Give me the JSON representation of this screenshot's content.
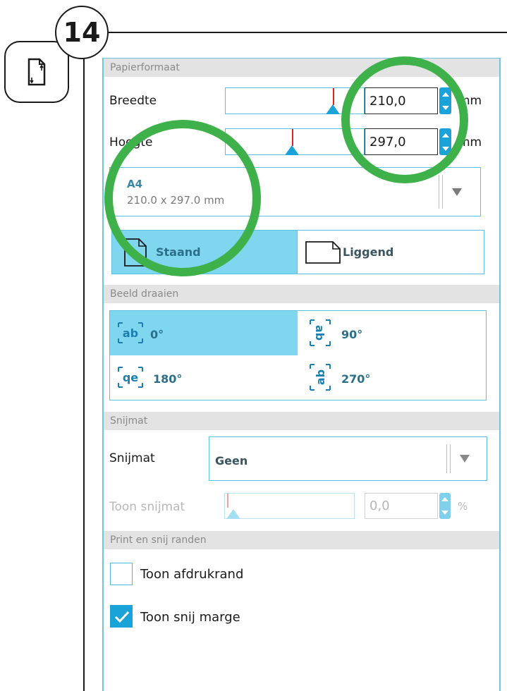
{
  "step_number": "14",
  "side_icon": "page-orientation-icon",
  "sections": {
    "paper": "Papierformaat",
    "rotate": "Beeld draaien",
    "mat": "Snijmat",
    "print_cut": "Print en snij randen"
  },
  "width": {
    "label": "Breedte",
    "value": "210,0",
    "unit": "mm"
  },
  "height": {
    "label": "Hoogte",
    "value": "297,0",
    "unit": "mm"
  },
  "paper_preset": {
    "name": "A4",
    "size": "210.0 x 297.0 mm"
  },
  "orientation": {
    "portrait": "Staand",
    "landscape": "Liggend",
    "selected": "Staand"
  },
  "rotation": {
    "options": [
      "0°",
      "90°",
      "180°",
      "270°"
    ],
    "selected": "0°",
    "glyph_ab": "ab",
    "glyph_qe": "qe"
  },
  "mat": {
    "label": "Snijmat",
    "value": "Geen",
    "show_label": "Toon snijmat",
    "show_value": "0,0",
    "show_unit": "%"
  },
  "print_cut": {
    "show_print_border": {
      "label": "Toon afdrukrand",
      "checked": false
    },
    "show_cut_margin": {
      "label": "Toon snij marge",
      "checked": true
    }
  },
  "colors": {
    "accent": "#1aa3d9",
    "selected_fill": "#7fd6ef",
    "highlight_ring": "#3fb14a",
    "slider_marker": "#e2241c"
  }
}
